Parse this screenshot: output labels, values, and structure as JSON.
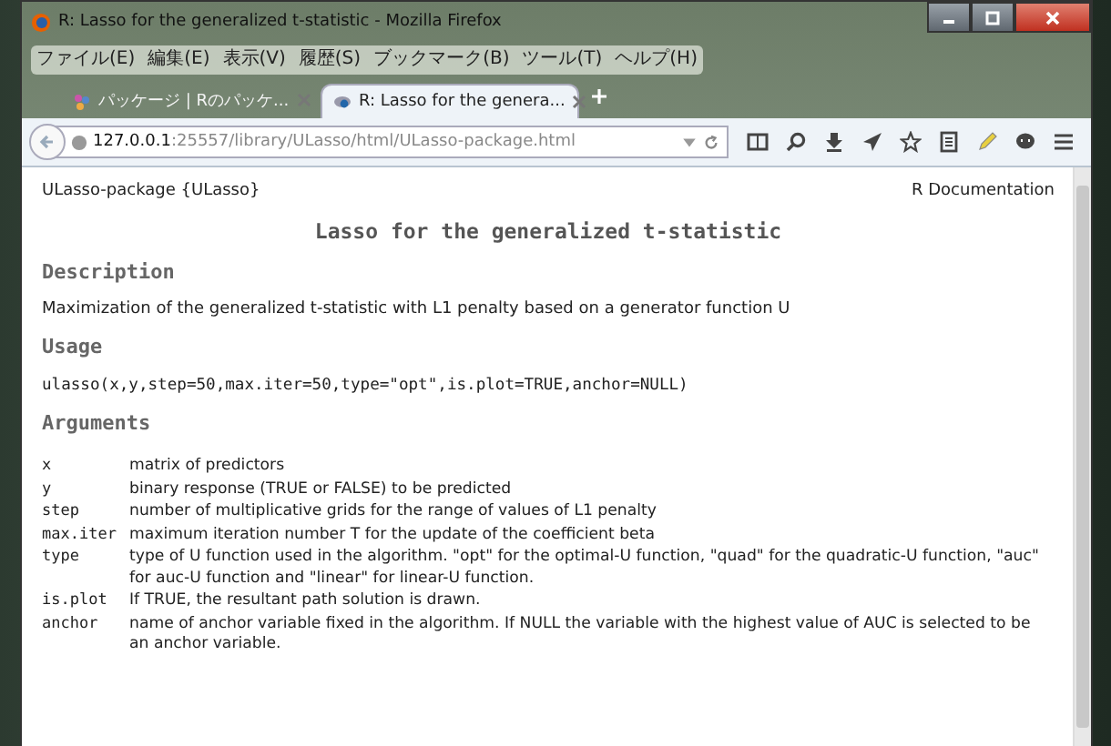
{
  "window": {
    "title": "R: Lasso for the generalized t-statistic - Mozilla Firefox"
  },
  "menu": [
    "ファイル(E)",
    "編集(E)",
    "表示(V)",
    "履歴(S)",
    "ブックマーク(B)",
    "ツール(T)",
    "ヘルプ(H)"
  ],
  "tabs": [
    {
      "label": "パッケージ | Rのパッケ...",
      "selected": false
    },
    {
      "label": "R: Lasso for the genera...",
      "selected": true
    }
  ],
  "address": {
    "host": "127.0.0.1",
    "path": ":25557/library/ULasso/html/ULasso-package.html"
  },
  "page": {
    "header_left": "ULasso-package {ULasso}",
    "header_right": "R Documentation",
    "title": "Lasso for the generalized t-statistic",
    "sections": [
      {
        "heading": "Description",
        "kind": "text",
        "text": "Maximization of the generalized t-statistic with L1 penalty based on a generator function U"
      },
      {
        "heading": "Usage",
        "kind": "code",
        "text": "ulasso(x,y,step=50,max.iter=50,type=\"opt\",is.plot=TRUE,anchor=NULL)"
      },
      {
        "heading": "Arguments",
        "kind": "arguments",
        "items": [
          {
            "name": "x",
            "text": "matrix of predictors"
          },
          {
            "name": "y",
            "text": "binary response (TRUE or FALSE) to be predicted"
          },
          {
            "name": "step",
            "text": "number of multiplicative grids for the range of values of L1 penalty"
          },
          {
            "name": "max.iter",
            "text": "maximum iteration number T for the update of the coefficient beta"
          },
          {
            "name": "type",
            "text": "type of U function used in the algorithm. \"opt\" for the optimal-U function, \"quad\" for the quadratic-U function, \"auc\" for auc-U function and \"linear\" for linear-U function."
          },
          {
            "name": "is.plot",
            "text": "If TRUE, the resultant path solution is drawn."
          },
          {
            "name": "anchor",
            "text": "name of anchor variable fixed in the algorithm. If NULL the variable with the highest value of AUC is selected to be an anchor variable."
          }
        ]
      }
    ]
  }
}
